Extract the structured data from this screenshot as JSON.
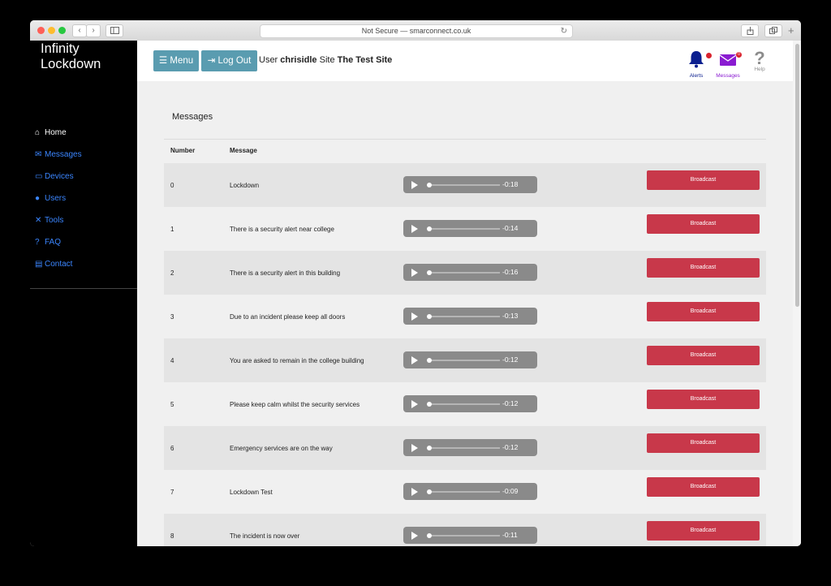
{
  "browser": {
    "url_text": "Not Secure — smarconnect.co.uk",
    "back_glyph": "‹",
    "forward_glyph": "›",
    "reload_glyph": "↻",
    "new_tab_glyph": "+"
  },
  "sidebar": {
    "brand_line1": "Infinity",
    "brand_line2": "Lockdown",
    "items": [
      {
        "icon": "home-icon",
        "glyph": "⌂",
        "label": "Home"
      },
      {
        "icon": "envelope-icon",
        "glyph": "✉",
        "label": "Messages"
      },
      {
        "icon": "laptop-icon",
        "glyph": "▭",
        "label": "Devices"
      },
      {
        "icon": "user-icon",
        "glyph": "●",
        "label": "Users"
      },
      {
        "icon": "tools-icon",
        "glyph": "✕",
        "label": "Tools"
      },
      {
        "icon": "question-icon",
        "glyph": "?",
        "label": "FAQ"
      },
      {
        "icon": "contact-card-icon",
        "glyph": "▤",
        "label": "Contact"
      }
    ]
  },
  "topbar": {
    "menu_label": "☰ Menu",
    "logout_label": "⇥ Log Out",
    "user_prefix": "User",
    "username": "chrisidle",
    "site_prefix": "Site",
    "site_name": "The Test Site",
    "alerts_label": "Alerts",
    "messages_label": "Messages",
    "messages_badge": "0",
    "help_label": "Help",
    "help_glyph": "?"
  },
  "content": {
    "heading": "Messages",
    "col_number": "Number",
    "col_message": "Message",
    "broadcast_label": "Broadcast",
    "rows": [
      {
        "number": "0",
        "message": "Lockdown",
        "time": "-0:18"
      },
      {
        "number": "1",
        "message": "There is a security alert near college",
        "time": "-0:14"
      },
      {
        "number": "2",
        "message": "There is a security alert in this building",
        "time": "-0:16"
      },
      {
        "number": "3",
        "message": "Due to an incident please keep all doors",
        "time": "-0:13"
      },
      {
        "number": "4",
        "message": "You are asked to remain in the college building",
        "time": "-0:12"
      },
      {
        "number": "5",
        "message": "Please keep calm whilst the security services",
        "time": "-0:12"
      },
      {
        "number": "6",
        "message": "Emergency services are on the way",
        "time": "-0:12"
      },
      {
        "number": "7",
        "message": "Lockdown Test",
        "time": "-0:09"
      },
      {
        "number": "8",
        "message": "The incident is now over",
        "time": "-0:11"
      }
    ]
  },
  "colors": {
    "accent_blue": "#3b86ff",
    "button_teal": "#5a9cb0",
    "broadcast_red": "#c8384a",
    "alert_navy": "#0b1f8f",
    "messages_purple": "#8a1bd1"
  }
}
